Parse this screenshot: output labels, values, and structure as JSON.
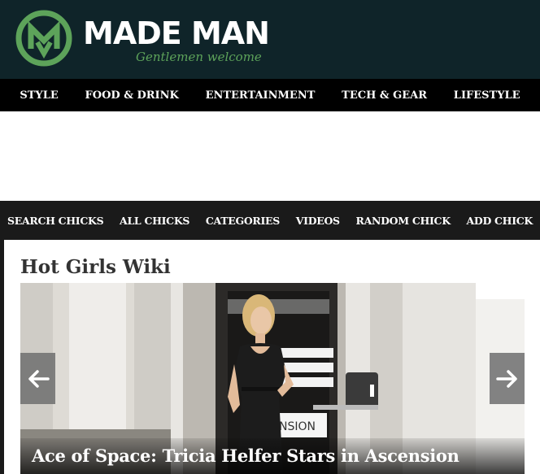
{
  "site": {
    "name": "MADE MAN",
    "tagline": "Gentlemen welcome",
    "brand_color": "#5da35a",
    "header_bg": "#0f2429"
  },
  "main_nav": {
    "items": [
      {
        "label": "STYLE"
      },
      {
        "label": "FOOD & DRINK"
      },
      {
        "label": "ENTERTAINMENT"
      },
      {
        "label": "TECH & GEAR"
      },
      {
        "label": "LIFESTYLE"
      }
    ]
  },
  "sub_nav": {
    "items": [
      {
        "label": "SEARCH CHICKS"
      },
      {
        "label": "ALL CHICKS"
      },
      {
        "label": "CATEGORIES"
      },
      {
        "label": "VIDEOS"
      },
      {
        "label": "RANDOM CHICK"
      },
      {
        "label": "ADD CHICK"
      }
    ]
  },
  "page": {
    "title": "Hot Girls Wiki"
  },
  "slider": {
    "caption": "Ace of Space: Tricia Helfer Stars in Ascension",
    "image_text": "NSION",
    "prev_icon": "arrow-left-icon",
    "next_icon": "arrow-right-icon"
  }
}
